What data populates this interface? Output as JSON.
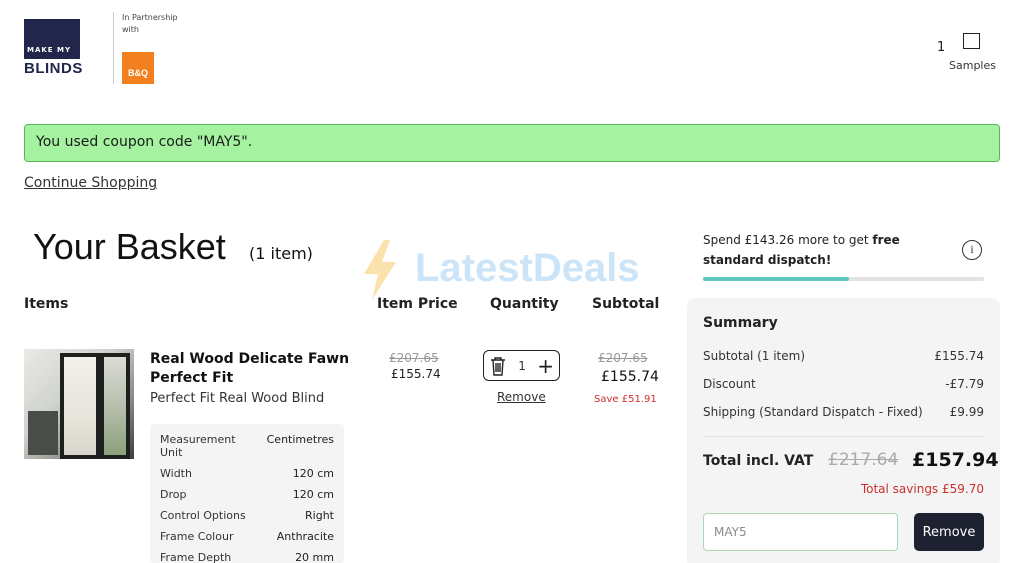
{
  "header": {
    "logo_small": "MAKE MY",
    "logo_main": "BLINDS",
    "partner_text": "In Partnership with",
    "partner_logo": "B&Q",
    "samples_count": "1",
    "samples_label": "Samples"
  },
  "banner": {
    "coupon_message": "You used coupon code \"MAY5\".",
    "continue_label": "Continue Shopping"
  },
  "basket": {
    "title": "Your Basket",
    "count": "(1 item)",
    "headers": {
      "items": "Items",
      "price": "Item Price",
      "quantity": "Quantity",
      "subtotal": "Subtotal"
    }
  },
  "watermark": "LatestDeals",
  "item": {
    "name": "Real Wood Delicate Fawn Perfect Fit",
    "subtitle": "Perfect Fit Real Wood Blind",
    "price_old": "£207.65",
    "price_new": "£155.74",
    "quantity": "1",
    "remove_label": "Remove",
    "subtotal_old": "£207.65",
    "subtotal_new": "£155.74",
    "save_text": "Save £51.91",
    "specs": [
      {
        "key": "Measurement Unit",
        "value": "Centimetres"
      },
      {
        "key": "Width",
        "value": "120 cm"
      },
      {
        "key": "Drop",
        "value": "120 cm"
      },
      {
        "key": "Control Options",
        "value": "Right"
      },
      {
        "key": "Frame Colour",
        "value": "Anthracite"
      },
      {
        "key": "Frame Depth",
        "value": "20 mm"
      }
    ]
  },
  "shipping_promo": {
    "text_before": "Spend £143.26 more to get ",
    "text_bold": "free standard dispatch!",
    "progress": 0.52,
    "progress_color": "#5fc6be"
  },
  "summary": {
    "title": "Summary",
    "rows": [
      {
        "label": "Subtotal (1 item)",
        "value": "£155.74"
      },
      {
        "label": "Discount",
        "value": "-£7.79"
      },
      {
        "label": "Shipping (Standard Dispatch - Fixed)",
        "value": "£9.99"
      }
    ],
    "total_label": "Total incl. VAT",
    "total_old": "£217.64",
    "total_new": "£157.94",
    "total_savings": "Total savings £59.70",
    "coupon_value": "MAY5",
    "remove_button": "Remove"
  },
  "colors": {
    "banner_bg": "#a5f3a1",
    "brand_navy": "#22264a",
    "bq_orange": "#f3801f",
    "savings_red": "#c9302c"
  }
}
